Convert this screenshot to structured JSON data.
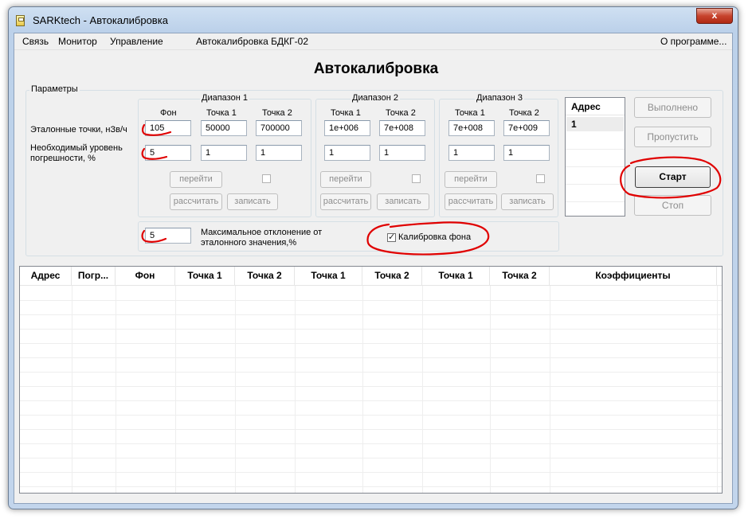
{
  "window": {
    "title": "SARKtech - Автокалибровка",
    "close_glyph": "x"
  },
  "menu": {
    "items": [
      "Связь",
      "Монитор",
      "Управление",
      "Автокалибровка БДКГ-02"
    ],
    "about": "О программе..."
  },
  "heading": "Автокалибровка",
  "params": {
    "group_label": "Параметры",
    "row_labels": {
      "points": "Эталонные точки, нЗв/ч",
      "error": "Необходимый уровень погрешности, %"
    },
    "range1": {
      "label": "Диапазон 1",
      "col_bg": "Фон",
      "col_p1": "Точка 1",
      "col_p2": "Точка 2",
      "bg": "105",
      "p1": "50000",
      "p2": "700000",
      "err_bg": "5",
      "err_p1": "1",
      "err_p2": "1"
    },
    "range2": {
      "label": "Диапазон 2",
      "col_p1": "Точка 1",
      "col_p2": "Точка 2",
      "p1": "1e+006",
      "p2": "7e+008",
      "err_p1": "1",
      "err_p2": "1"
    },
    "range3": {
      "label": "Диапазон 3",
      "col_p1": "Точка 1",
      "col_p2": "Точка 2",
      "p1": "7e+008",
      "p2": "7e+009",
      "err_p1": "1",
      "err_p2": "1"
    },
    "buttons": {
      "goto": "перейти",
      "calc": "рассчитать",
      "write": "записать"
    },
    "max_dev": {
      "value": "5",
      "label": "Максимальное отклонение от эталонного значения,%"
    },
    "bg_calibration": {
      "label": "Калибровка фона",
      "checked": true
    }
  },
  "address_list": {
    "header": "Адрес",
    "items": [
      "1"
    ]
  },
  "actions": {
    "done": "Выполнено",
    "skip": "Пропустить",
    "start": "Старт",
    "stop": "Стоп"
  },
  "results": {
    "columns": [
      "Адрес",
      "Погр...",
      "Фон",
      "Точка 1",
      "Точка 2",
      "Точка 1",
      "Точка 2",
      "Точка 1",
      "Точка 2",
      "Коэффициенты"
    ]
  },
  "colors": {
    "annotation": "#e00000",
    "titlebar": "#c2d5ec",
    "close": "#c7432d"
  }
}
